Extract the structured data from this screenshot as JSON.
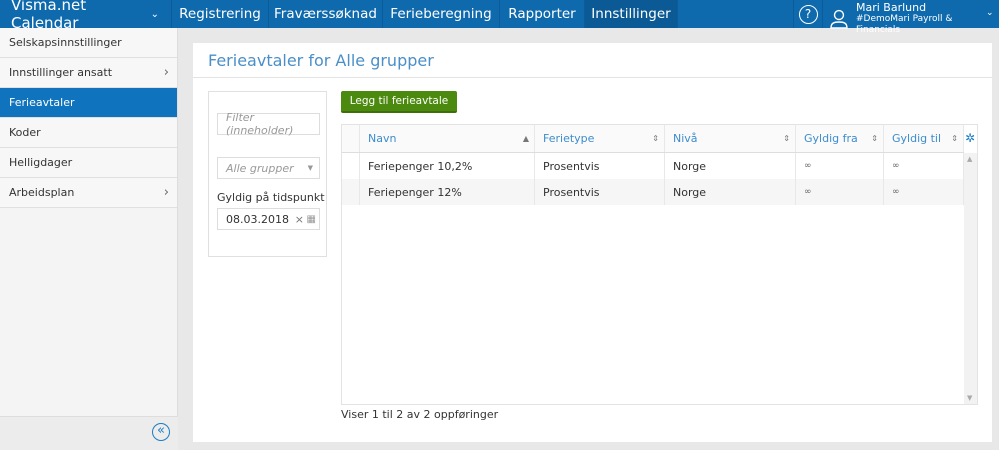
{
  "header": {
    "brand": "Visma.net Calendar",
    "nav": [
      "Registrering",
      "Fraværssøknad",
      "Ferieberegning",
      "Rapporter",
      "Innstillinger"
    ],
    "active_nav": "Innstillinger",
    "help": "?",
    "user_name": "Mari Barlund",
    "user_org": "#DemoMari Payroll & Financials"
  },
  "sidebar": {
    "items": [
      {
        "label": "Selskapsinnstillinger"
      },
      {
        "label": "Innstillinger ansatt"
      },
      {
        "label": "Ferieavtaler"
      },
      {
        "label": "Koder"
      },
      {
        "label": "Helligdager"
      },
      {
        "label": "Arbeidsplan"
      }
    ],
    "active": "Ferieavtaler",
    "collapse": "«"
  },
  "page": {
    "title": "Ferieavtaler for Alle grupper",
    "add_button": "Legg til ferieavtale",
    "filter": {
      "placeholder": "Filter (inneholder)",
      "group_placeholder": "Alle grupper",
      "date_label": "Gyldig på tidspunkt",
      "date_value": "08.03.2018"
    },
    "table": {
      "columns": [
        "Navn",
        "Ferietype",
        "Nivå",
        "Gyldig fra",
        "Gyldig til"
      ],
      "rows": [
        [
          "Feriepenger 10,2%",
          "Prosentvis",
          "Norge",
          "∞",
          "∞"
        ],
        [
          "Feriepenger 12%",
          "Prosentvis",
          "Norge",
          "∞",
          "∞"
        ]
      ]
    },
    "footer": "Viser 1 til 2 av 2 oppføringer"
  },
  "colors": {
    "topbar": "#0f6aad",
    "active_sidebar": "#0f74bd",
    "button": "#4b8a0e",
    "link": "#3d8ccc"
  }
}
